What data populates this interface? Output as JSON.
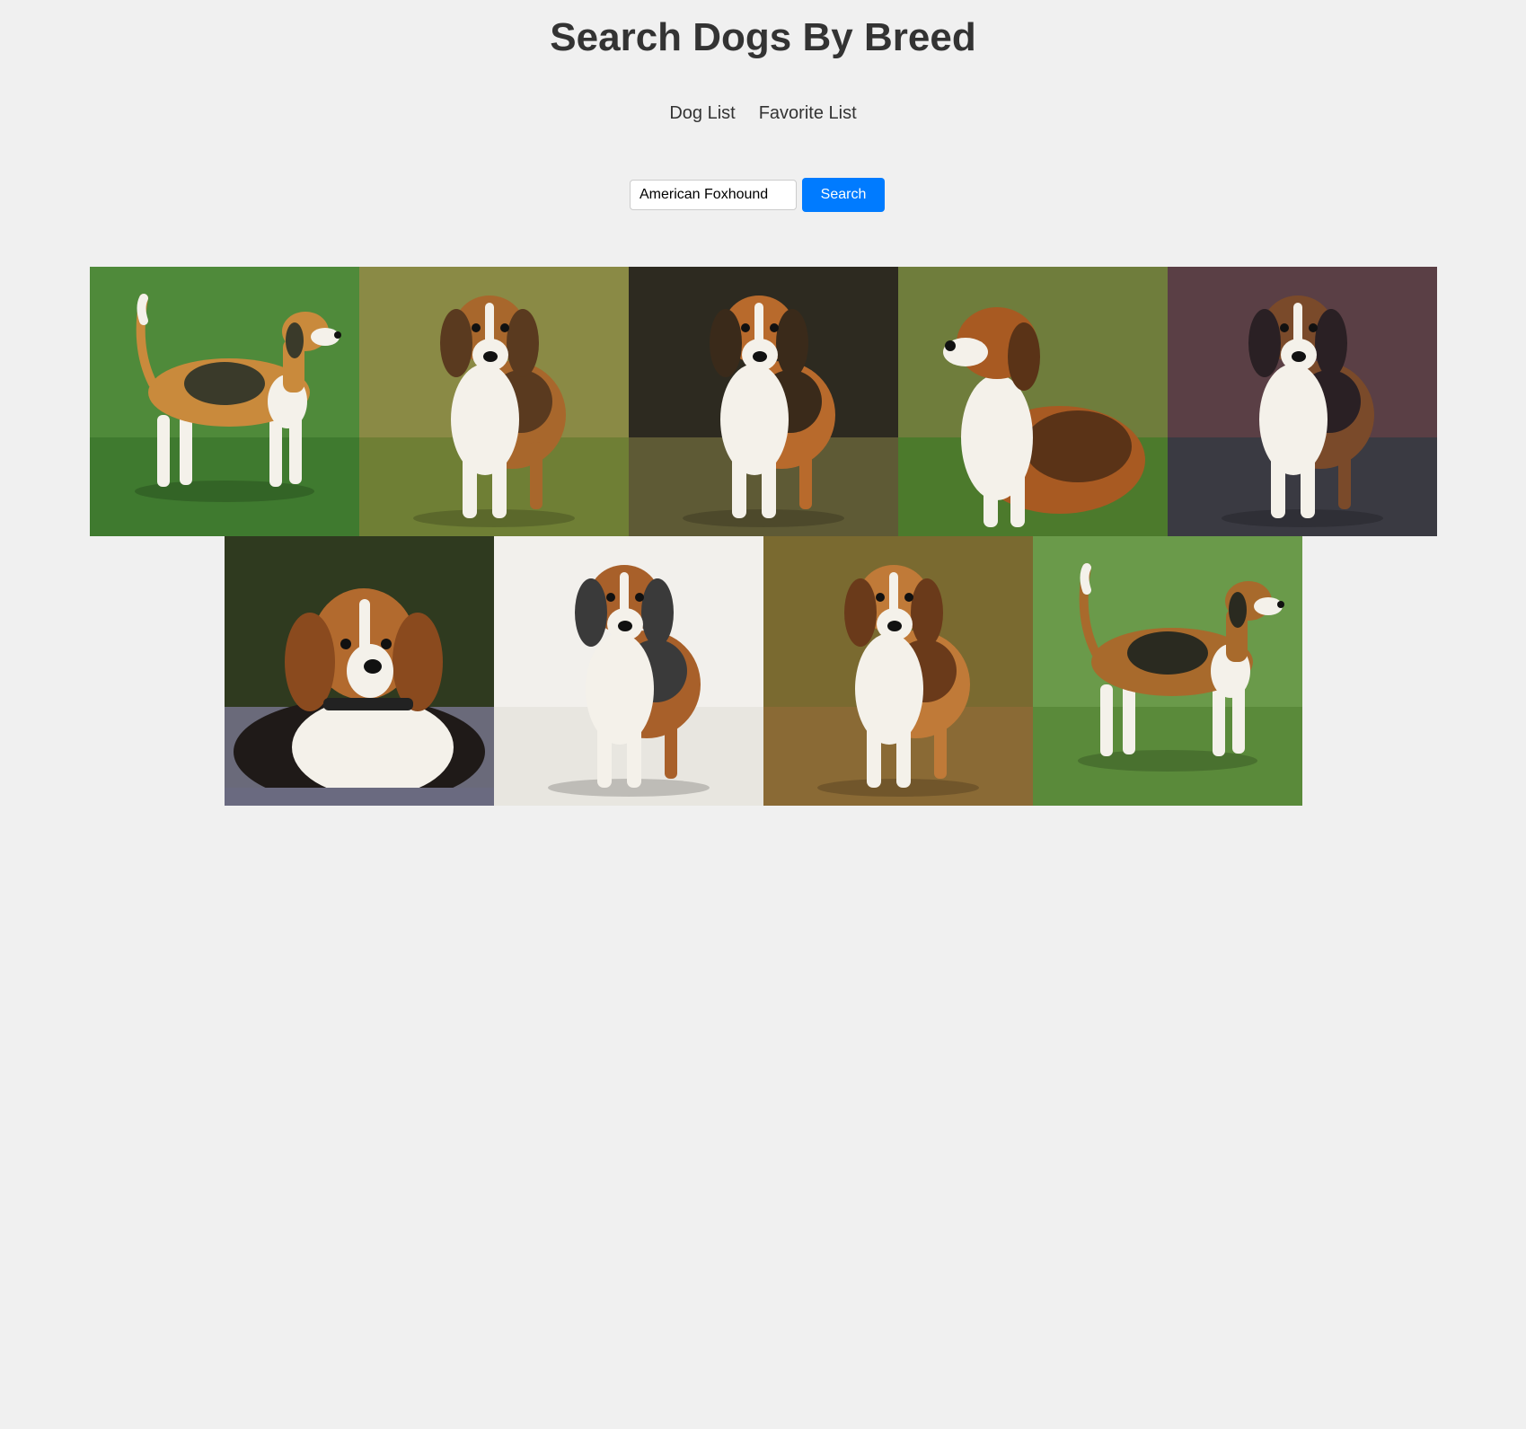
{
  "header": {
    "title": "Search Dogs By Breed"
  },
  "nav": {
    "items": [
      {
        "label": "Dog List"
      },
      {
        "label": "Favorite List"
      }
    ]
  },
  "search": {
    "value": "American Foxhound",
    "button_label": "Search"
  },
  "gallery": {
    "breed": "American Foxhound",
    "images": [
      {
        "name": "dog-photo-1",
        "background": "#4f8a3a",
        "ground": "#3f7a2f",
        "pose": "stand-right",
        "coat_main": "#c98a3c",
        "coat_dark": "#3a3a2a"
      },
      {
        "name": "dog-photo-2",
        "background": "#8a8a45",
        "ground": "#6f7f35",
        "pose": "stand-front",
        "coat_main": "#a8672c",
        "coat_dark": "#5a3a1f"
      },
      {
        "name": "dog-photo-3",
        "background": "#2d2a20",
        "ground": "#5e5a35",
        "pose": "stand-front",
        "coat_main": "#b86a2c",
        "coat_dark": "#3a2a1a"
      },
      {
        "name": "dog-photo-4",
        "background": "#6f7d3c",
        "ground": "#4c7a2c",
        "pose": "sit-left",
        "coat_main": "#a85a22",
        "coat_dark": "#5a3317"
      },
      {
        "name": "dog-photo-5",
        "background": "#5a3f45",
        "ground": "#3a3a42",
        "pose": "stand-front",
        "coat_main": "#7a4a2a",
        "coat_dark": "#2a2024"
      },
      {
        "name": "dog-photo-6",
        "background": "#2f3a1f",
        "ground": "#6a6a7a",
        "pose": "lie-front",
        "coat_main": "#b26a2e",
        "coat_dark": "#1f1a18"
      },
      {
        "name": "dog-photo-7",
        "background": "#f2f0ec",
        "ground": "#e8e6e0",
        "pose": "stand-front",
        "coat_main": "#a8602a",
        "coat_dark": "#3a3a3a"
      },
      {
        "name": "dog-photo-8",
        "background": "#7a6a30",
        "ground": "#8a6a35",
        "pose": "stand-front",
        "coat_main": "#c07a38",
        "coat_dark": "#6a3a1a"
      },
      {
        "name": "dog-photo-9",
        "background": "#6a9a4a",
        "ground": "#5a8a3a",
        "pose": "stand-right",
        "coat_main": "#a86a2c",
        "coat_dark": "#2a2a20"
      }
    ]
  }
}
